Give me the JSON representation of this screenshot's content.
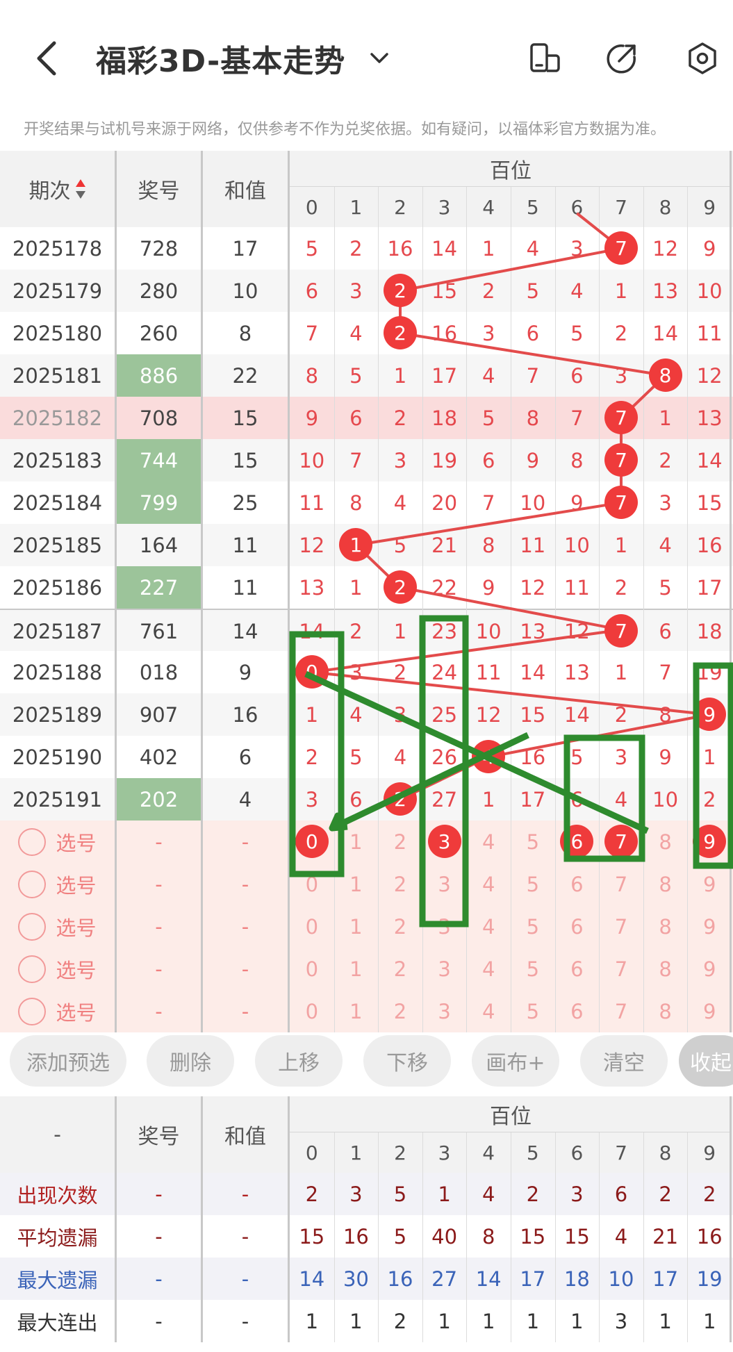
{
  "header": {
    "title": "福彩3D-基本走势",
    "notice": "开奖结果与试机号来源于网络，仅供参考不作为兑奖依据。如有疑问，以福体彩官方数据为准。"
  },
  "icons": [
    "back-arrow-icon",
    "chevron-down-icon",
    "phone-rotate-icon",
    "share-icon",
    "settings-icon"
  ],
  "colors": {
    "miss": "#e5484d",
    "ball": "#ef3b3b",
    "highlight_num_bg": "#9cc49a",
    "draw_green": "#2e8b2e",
    "max_miss": "#3a63b8",
    "label_dark_red": "#8b1a1a"
  },
  "main_table": {
    "col_issue": "期次",
    "col_number": "奖号",
    "col_sum": "和值",
    "group_title": "百位",
    "digits": [
      "0",
      "1",
      "2",
      "3",
      "4",
      "5",
      "6",
      "7",
      "8",
      "9"
    ],
    "rows": [
      {
        "issue": "2025178",
        "number": "728",
        "sum": "17",
        "cells": [
          "5",
          "2",
          "16",
          "14",
          "1",
          "4",
          "3",
          "7",
          "12",
          "9"
        ],
        "hit": 7,
        "green": false,
        "pink": false
      },
      {
        "issue": "2025179",
        "number": "280",
        "sum": "10",
        "cells": [
          "6",
          "3",
          "2",
          "15",
          "2",
          "5",
          "4",
          "1",
          "13",
          "10"
        ],
        "hit": 2,
        "green": false,
        "pink": false
      },
      {
        "issue": "2025180",
        "number": "260",
        "sum": "8",
        "cells": [
          "7",
          "4",
          "2",
          "16",
          "3",
          "6",
          "5",
          "2",
          "14",
          "11"
        ],
        "hit": 2,
        "green": false,
        "pink": false
      },
      {
        "issue": "2025181",
        "number": "886",
        "sum": "22",
        "cells": [
          "8",
          "5",
          "1",
          "17",
          "4",
          "7",
          "6",
          "3",
          "8",
          "12"
        ],
        "hit": 8,
        "green": true,
        "pink": false
      },
      {
        "issue": "2025182",
        "number": "708",
        "sum": "15",
        "cells": [
          "9",
          "6",
          "2",
          "18",
          "5",
          "8",
          "7",
          "7",
          "1",
          "13"
        ],
        "hit": 7,
        "green": false,
        "pink": true
      },
      {
        "issue": "2025183",
        "number": "744",
        "sum": "15",
        "cells": [
          "10",
          "7",
          "3",
          "19",
          "6",
          "9",
          "8",
          "7",
          "2",
          "14"
        ],
        "hit": 7,
        "green": true,
        "pink": false
      },
      {
        "issue": "2025184",
        "number": "799",
        "sum": "25",
        "cells": [
          "11",
          "8",
          "4",
          "20",
          "7",
          "10",
          "9",
          "7",
          "3",
          "15"
        ],
        "hit": 7,
        "green": true,
        "pink": false
      },
      {
        "issue": "2025185",
        "number": "164",
        "sum": "11",
        "cells": [
          "12",
          "1",
          "5",
          "21",
          "8",
          "11",
          "10",
          "1",
          "4",
          "16"
        ],
        "hit": 1,
        "green": false,
        "pink": false
      },
      {
        "issue": "2025186",
        "number": "227",
        "sum": "11",
        "cells": [
          "13",
          "1",
          "2",
          "22",
          "9",
          "12",
          "11",
          "2",
          "5",
          "17"
        ],
        "hit": 2,
        "green": true,
        "pink": false
      },
      {
        "issue": "2025187",
        "number": "761",
        "sum": "14",
        "cells": [
          "14",
          "2",
          "1",
          "23",
          "10",
          "13",
          "12",
          "7",
          "6",
          "18"
        ],
        "hit": 7,
        "green": false,
        "pink": false
      },
      {
        "issue": "2025188",
        "number": "018",
        "sum": "9",
        "cells": [
          "0",
          "3",
          "2",
          "24",
          "11",
          "14",
          "13",
          "1",
          "7",
          "19"
        ],
        "hit": 0,
        "green": false,
        "pink": false
      },
      {
        "issue": "2025189",
        "number": "907",
        "sum": "16",
        "cells": [
          "1",
          "4",
          "3",
          "25",
          "12",
          "15",
          "14",
          "2",
          "8",
          "9"
        ],
        "hit": 9,
        "green": false,
        "pink": false
      },
      {
        "issue": "2025190",
        "number": "402",
        "sum": "6",
        "cells": [
          "2",
          "5",
          "4",
          "26",
          "4",
          "16",
          "5",
          "3",
          "9",
          "1"
        ],
        "hit": 4,
        "green": false,
        "pink": false
      },
      {
        "issue": "2025191",
        "number": "202",
        "sum": "4",
        "cells": [
          "3",
          "6",
          "2",
          "27",
          "1",
          "17",
          "6",
          "4",
          "10",
          "2"
        ],
        "hit": 2,
        "green": true,
        "pink": false
      }
    ],
    "select_label": "选号",
    "dash": "-",
    "select_rows": [
      {
        "cells": [
          "0",
          "1",
          "2",
          "3",
          "4",
          "5",
          "6",
          "7",
          "8",
          "9"
        ],
        "picked": [
          0,
          3,
          6,
          7,
          9
        ]
      },
      {
        "cells": [
          "0",
          "1",
          "2",
          "3",
          "4",
          "5",
          "6",
          "7",
          "8",
          "9"
        ],
        "picked": []
      },
      {
        "cells": [
          "0",
          "1",
          "2",
          "3",
          "4",
          "5",
          "6",
          "7",
          "8",
          "9"
        ],
        "picked": []
      },
      {
        "cells": [
          "0",
          "1",
          "2",
          "3",
          "4",
          "5",
          "6",
          "7",
          "8",
          "9"
        ],
        "picked": []
      },
      {
        "cells": [
          "0",
          "1",
          "2",
          "3",
          "4",
          "5",
          "6",
          "7",
          "8",
          "9"
        ],
        "picked": []
      }
    ]
  },
  "buttons": {
    "add": "添加预选",
    "delete": "删除",
    "up": "上移",
    "down": "下移",
    "canvas": "画布+",
    "clear": "清空",
    "collapse": "收起"
  },
  "stats_table": {
    "col_issue": "-",
    "col_number": "奖号",
    "col_sum": "和值",
    "group_title": "百位",
    "digits": [
      "0",
      "1",
      "2",
      "3",
      "4",
      "5",
      "6",
      "7",
      "8",
      "9"
    ],
    "rows": [
      {
        "label": "出现次数",
        "number": "-",
        "sum": "-",
        "cells": [
          "2",
          "3",
          "5",
          "1",
          "4",
          "2",
          "3",
          "6",
          "2",
          "2"
        ],
        "style": "appear"
      },
      {
        "label": "平均遗漏",
        "number": "-",
        "sum": "-",
        "cells": [
          "15",
          "16",
          "5",
          "40",
          "8",
          "15",
          "15",
          "4",
          "21",
          "16"
        ],
        "style": "avg"
      },
      {
        "label": "最大遗漏",
        "number": "-",
        "sum": "-",
        "cells": [
          "14",
          "30",
          "16",
          "27",
          "14",
          "17",
          "18",
          "10",
          "17",
          "19"
        ],
        "style": "max"
      },
      {
        "label": "最大连出",
        "number": "-",
        "sum": "-",
        "cells": [
          "1",
          "1",
          "2",
          "1",
          "1",
          "1",
          "1",
          "3",
          "1",
          "1"
        ],
        "style": "streak"
      }
    ]
  }
}
